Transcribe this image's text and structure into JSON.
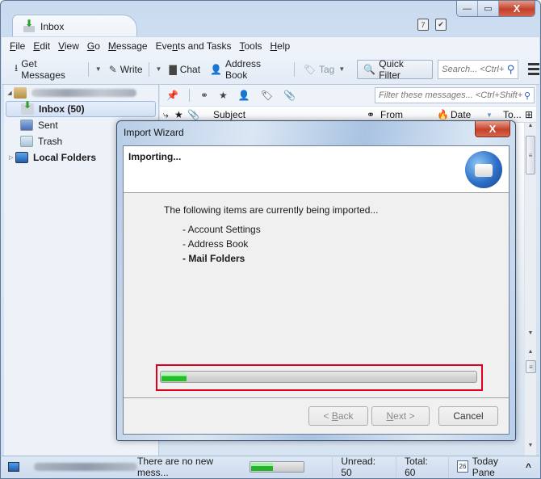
{
  "window": {
    "tab_title": "Inbox",
    "controls": {
      "minimize": "—",
      "maximize": "▭",
      "close": "X"
    },
    "calendar_icons": [
      "7",
      "✔"
    ]
  },
  "menubar": {
    "items": [
      {
        "label": "File",
        "accel": "F"
      },
      {
        "label": "Edit",
        "accel": "E"
      },
      {
        "label": "View",
        "accel": "V"
      },
      {
        "label": "Go",
        "accel": "G"
      },
      {
        "label": "Message",
        "accel": "M"
      },
      {
        "label": "Events and Tasks",
        "accel": "n"
      },
      {
        "label": "Tools",
        "accel": "T"
      },
      {
        "label": "Help",
        "accel": "H"
      }
    ]
  },
  "toolbar": {
    "get_messages": "Get Messages",
    "write": "Write",
    "chat": "Chat",
    "address_book": "Address Book",
    "tag": "Tag",
    "quick_filter": "Quick Filter",
    "search_placeholder": "Search... <Ctrl+"
  },
  "folders": {
    "account": "[email hidden]@gmail.com",
    "items": [
      {
        "label": "Inbox (50)",
        "selected": true
      },
      {
        "label": "Sent"
      },
      {
        "label": "Trash"
      },
      {
        "label": "Local Folders"
      }
    ]
  },
  "quick_filter_bar": {
    "filter_placeholder": "Filter these messages... <Ctrl+Shift+"
  },
  "columns": {
    "subject": "Subject",
    "from": "From",
    "date": "Date",
    "to": "To..."
  },
  "dialog": {
    "title": "Import Wizard",
    "close": "X",
    "heading": "Importing...",
    "intro": "The following items are currently being imported...",
    "items": [
      {
        "label": "- Account Settings",
        "current": false
      },
      {
        "label": "- Address Book",
        "current": false
      },
      {
        "label": "- Mail Folders",
        "current": true
      }
    ],
    "progress_percent": 8,
    "buttons": {
      "back": "< Back",
      "next": "Next >",
      "cancel": "Cancel"
    },
    "highlight_color": "#e0001b"
  },
  "statusbar": {
    "account": "[email hidden]@gmail.com",
    "message": "There are no new mess...",
    "progress_percent": 40,
    "unread": "Unread: 50",
    "total": "Total: 60",
    "today_pane": "Today Pane",
    "today_icon_day": "26",
    "today_toggle": "^"
  }
}
